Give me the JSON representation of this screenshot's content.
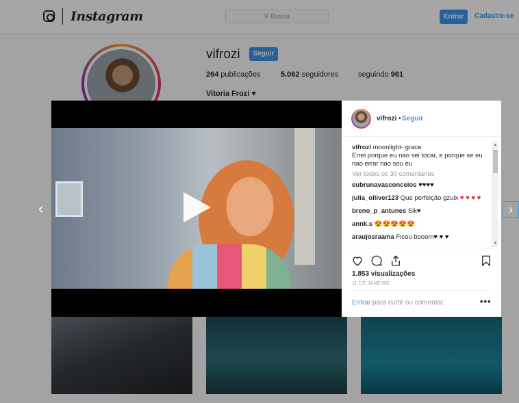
{
  "header": {
    "logo_text": "Instagram",
    "search_placeholder": "Busca",
    "login_button": "Entrar",
    "signup_link": "Cadastre-se"
  },
  "profile": {
    "username": "vifrozi",
    "follow_button": "Seguir",
    "posts": "264",
    "posts_label": "publicações",
    "followers": "5.062",
    "followers_label": "seguidores",
    "following_label": "seguindo",
    "following": "961",
    "full_name": "Vitoria Frozi ♥"
  },
  "post": {
    "username": "vifrozi",
    "dot": "•",
    "follow_link": "Seguir",
    "caption_user": "vifrozi",
    "caption_text": "moonlight- grace",
    "caption_body": "Errei porque eu nao sei tocar, e porque se eu nao errar nao sou eu",
    "view_all_comments": "Ver todos os 30 comentários",
    "comments": [
      {
        "user": "eubrunavasconcelos",
        "text": "",
        "hearts": "♥♥♥♥",
        "heart_color": "black"
      },
      {
        "user": "julia_olliver123",
        "text": "Que perfeição gzuix",
        "hearts": "♥ ♥ ♥ ♥",
        "heart_color": "red"
      },
      {
        "user": "breno_p_antunes",
        "text": "Sik♥",
        "hearts": "",
        "heart_color": "black"
      },
      {
        "user": "annk.s",
        "text": "",
        "hearts": "😍😍😍😍😍",
        "heart_color": "emoji"
      },
      {
        "user": "araujosraama",
        "text": "Ficou booom",
        "hearts": "♥ ♥ ♥",
        "heart_color": "black"
      }
    ],
    "views": "1.853 visualizações",
    "date": "11 DE JANEIRO",
    "login_link": "Entrar",
    "login_text": " para curtir ou comentar.",
    "more": "•••"
  },
  "icons": {
    "heart": "heart-icon",
    "comment": "comment-icon",
    "share": "share-icon",
    "save": "bookmark-icon",
    "play": "play-icon",
    "prev": "chevron-left-icon",
    "next": "chevron-right-icon"
  },
  "colors": {
    "accent": "#3897f0",
    "heart_red": "#ed1c24"
  }
}
